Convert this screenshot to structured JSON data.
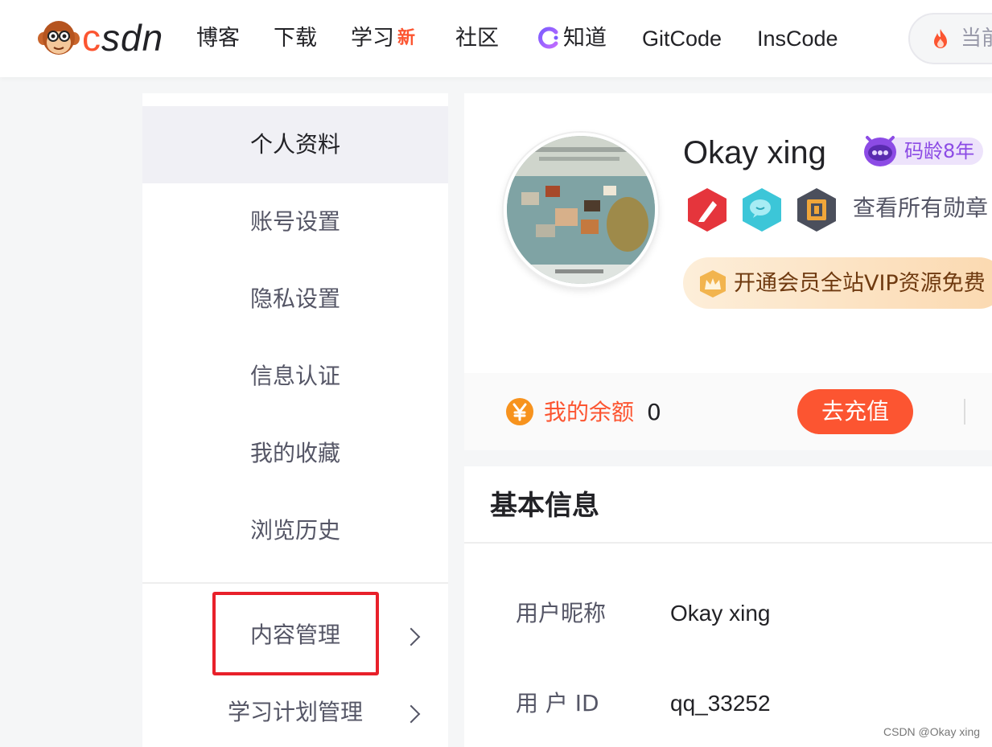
{
  "header": {
    "logo_text": "csdn",
    "nav": [
      {
        "label": "博客"
      },
      {
        "label": "下载"
      },
      {
        "label": "学习",
        "badge": "新"
      },
      {
        "label": "社区"
      },
      {
        "label": "知道"
      },
      {
        "label": "GitCode"
      },
      {
        "label": "InsCode"
      }
    ],
    "search_placeholder": "当前"
  },
  "sidebar": {
    "items": [
      {
        "label": "个人资料",
        "active": true
      },
      {
        "label": "账号设置"
      },
      {
        "label": "隐私设置"
      },
      {
        "label": "信息认证"
      },
      {
        "label": "我的收藏"
      },
      {
        "label": "浏览历史"
      },
      {
        "label": "内容管理",
        "has_submenu": true,
        "highlighted": true
      },
      {
        "label": "学习计划管理",
        "has_submenu": true
      }
    ]
  },
  "profile": {
    "username": "Okay xing",
    "code_age_badge": "码龄8年",
    "medals_link": "查看所有勋章",
    "medal_icons": [
      "pen-medal-icon",
      "chat-medal-icon",
      "persistence-medal-icon"
    ],
    "vip_banner": "开通会员全站VIP资源免费"
  },
  "balance": {
    "label": "我的余额",
    "value": "0",
    "recharge_label": "去充值"
  },
  "basic_info": {
    "title": "基本信息",
    "rows": [
      {
        "label": "用户昵称",
        "value": "Okay xing"
      },
      {
        "label": "用 户 ID",
        "value": "qq_33252"
      }
    ]
  },
  "watermark": "CSDN @Okay xing",
  "colors": {
    "brand": "#fc5531",
    "highlight_border": "#e8202a",
    "badge_purple": "#8c4be5"
  }
}
